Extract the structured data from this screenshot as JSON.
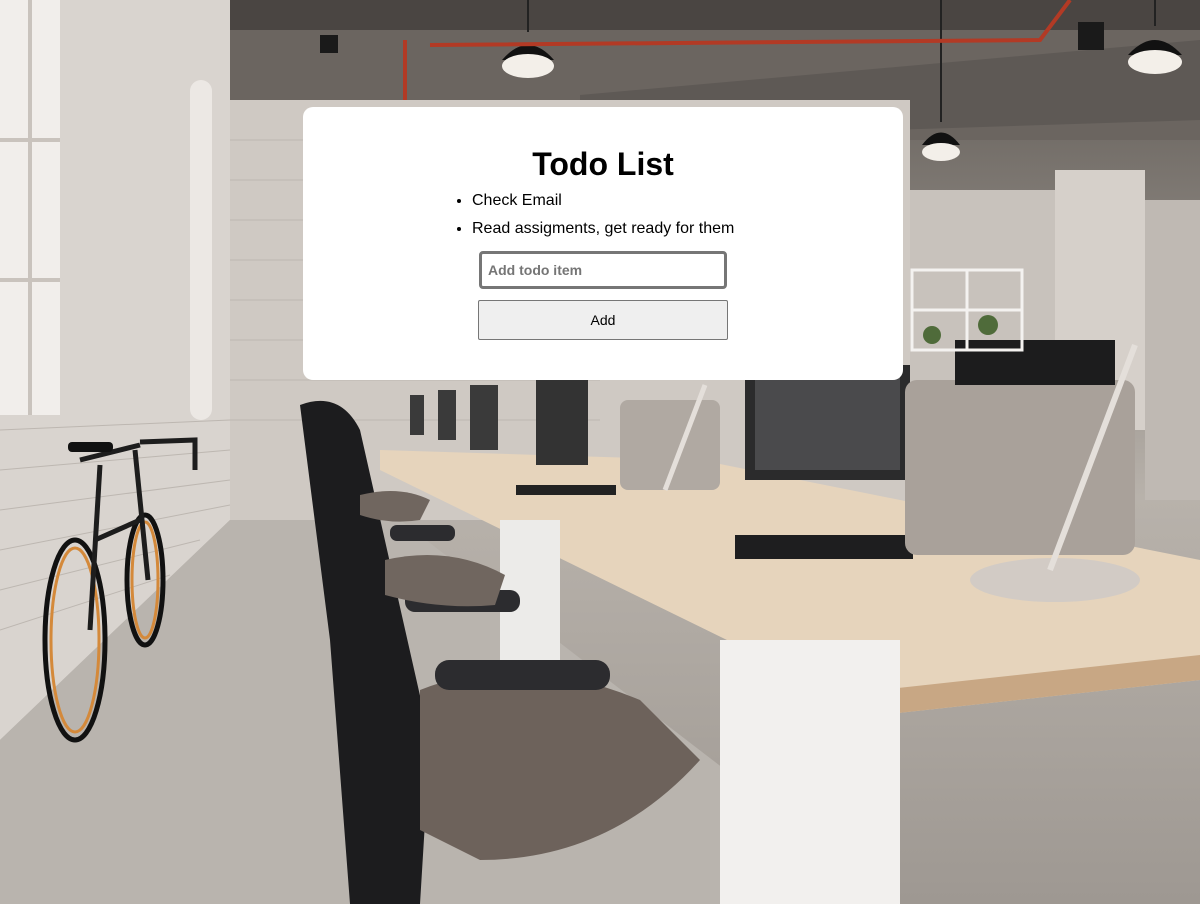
{
  "app": {
    "title": "Todo List"
  },
  "todos": {
    "items": [
      {
        "label": "Check Email"
      },
      {
        "label": "Read assigments, get ready for them"
      }
    ]
  },
  "form": {
    "input_value": "",
    "input_placeholder": "Add todo item",
    "add_label": "Add"
  },
  "background": {
    "description_icon": "office-background-image"
  },
  "colors": {
    "card": "#ffffff",
    "button_bg": "#efefef",
    "input_border": "#767676"
  }
}
